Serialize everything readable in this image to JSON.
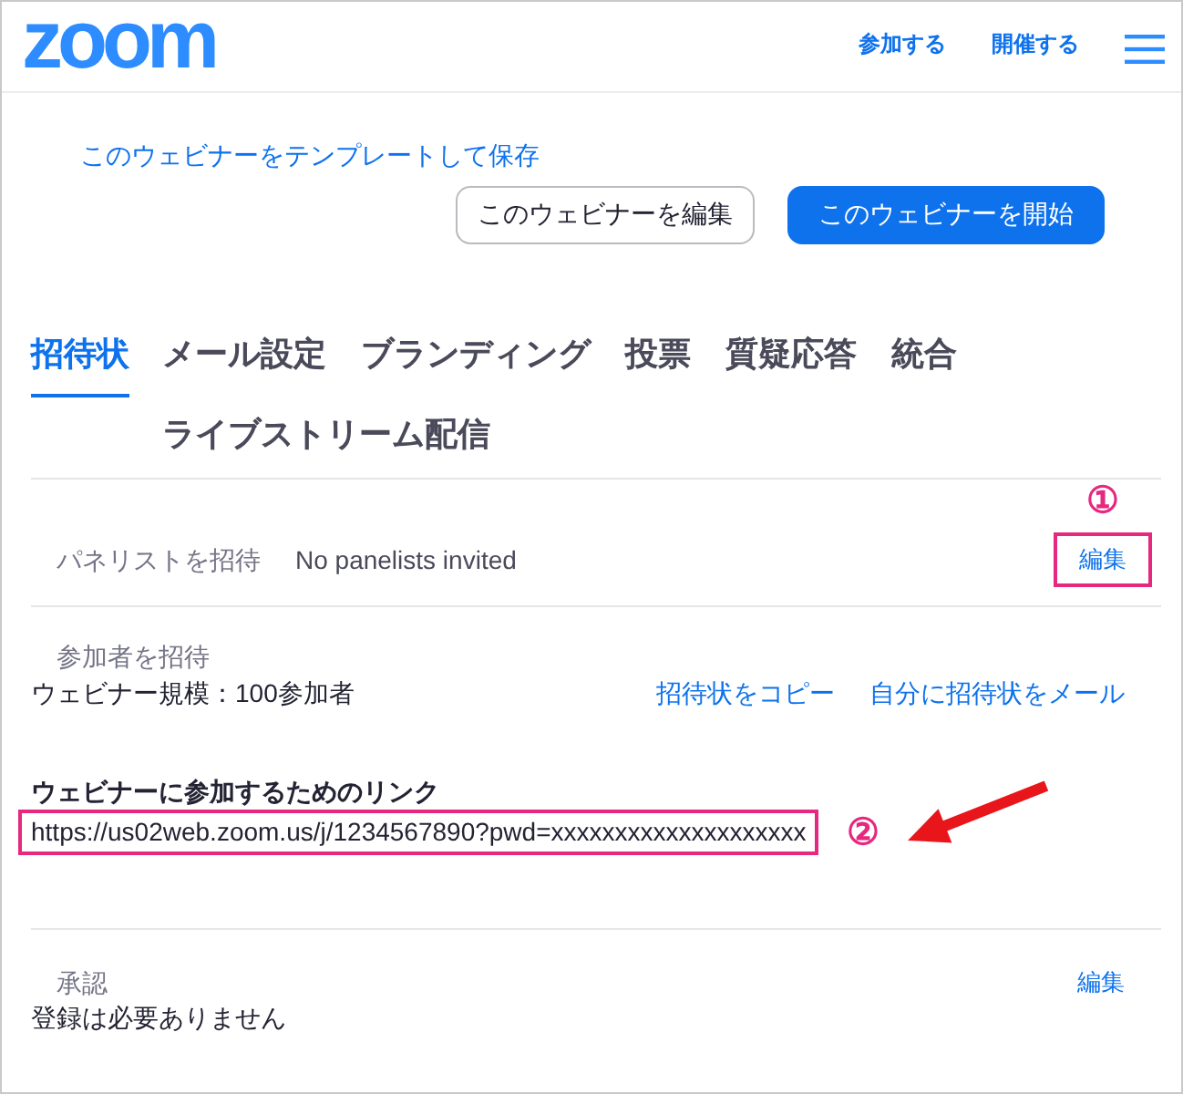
{
  "header": {
    "logo": "zoom",
    "links": [
      "参加する",
      "開催する"
    ]
  },
  "actions": {
    "save_template_link": "このウェビナーをテンプレートして保存",
    "buttons": [
      {
        "label": "このウェビナーを編集",
        "kind": "secondary"
      },
      {
        "label": "このウェビナーを開始",
        "kind": "primary"
      }
    ]
  },
  "tabs": [
    {
      "label": "招待状",
      "selected": true
    },
    {
      "label": "メール設定",
      "selected": false
    },
    {
      "label": "ブランディング",
      "selected": false
    },
    {
      "label": "投票",
      "selected": false
    },
    {
      "label": "質疑応答",
      "selected": false
    },
    {
      "label": "統合",
      "selected": false
    },
    {
      "label": "ライブストリーム配信",
      "selected": false
    }
  ],
  "panelists": {
    "label": "パネリストを招待",
    "value": "No panelists invited",
    "edit_link": "編集",
    "highlighted": true,
    "callout": "①"
  },
  "attendees": {
    "label": "参加者を招待",
    "capacity": "ウェビナー規模：100参加者",
    "links": [
      "招待状をコピー",
      "自分に招待状をメール"
    ]
  },
  "join_link": {
    "label": "ウェビナーに参加するためのリンク",
    "url": "https://us02web.zoom.us/j/1234567890?pwd=xxxxxxxxxxxxxxxxxxxx",
    "highlighted": true,
    "callout": "②"
  },
  "approval": {
    "label": "承認",
    "edit_link": "編集",
    "value": "登録は必要ありません"
  }
}
